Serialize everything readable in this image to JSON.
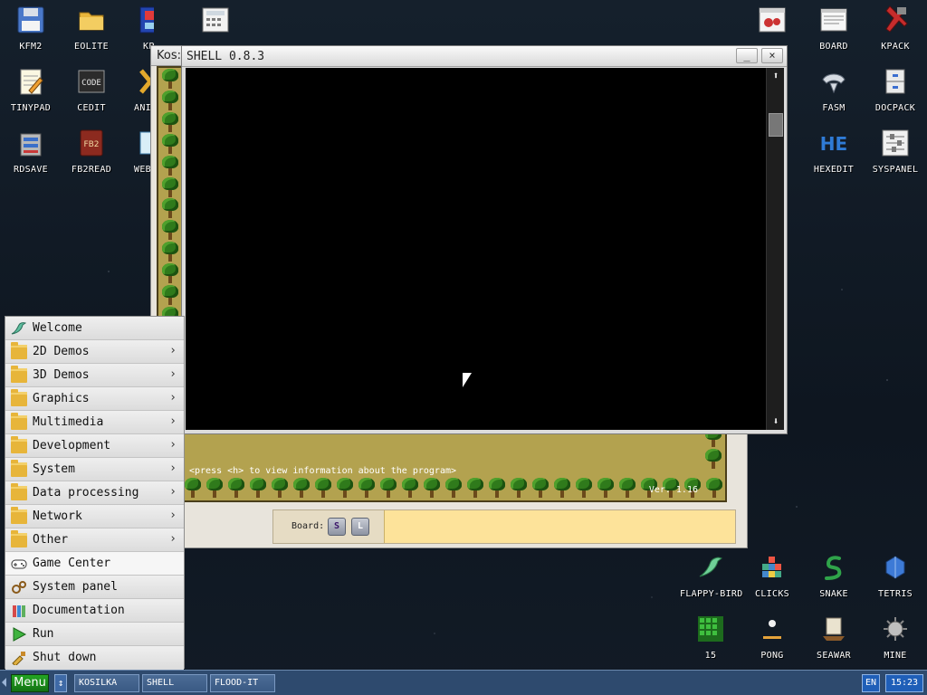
{
  "desktop": {
    "left_icons": [
      {
        "label": "KFM2",
        "icon": "floppy-disk-icon"
      },
      {
        "label": "EOLITE",
        "icon": "folder-icon"
      },
      {
        "label": "KP",
        "icon": "kpaint-icon"
      },
      {
        "label": "",
        "icon": "calculator-icon"
      },
      {
        "label": "TINYPAD",
        "icon": "notepad-icon"
      },
      {
        "label": "CEDIT",
        "icon": "code-editor-icon"
      },
      {
        "label": "ANI",
        "icon": "animation-icon"
      },
      {
        "label": "RDSAVE",
        "icon": "ramdisk-save-icon"
      },
      {
        "label": "FB2READ",
        "icon": "book-reader-icon"
      },
      {
        "label": "WEB",
        "icon": "web-browser-icon"
      }
    ],
    "right_icons": [
      {
        "label": "",
        "icon": "debugger-icon"
      },
      {
        "label": "BOARD",
        "icon": "board-icon"
      },
      {
        "label": "KPACK",
        "icon": "kpack-icon"
      },
      {
        "label": "FASM",
        "icon": "fasm-icon"
      },
      {
        "label": "DOCPACK",
        "icon": "docpack-icon"
      },
      {
        "label": "HEXEDIT",
        "icon": "hex-editor-icon"
      },
      {
        "label": "SYSPANEL",
        "icon": "syspanel-icon"
      }
    ],
    "game_icons": [
      {
        "label": "FLAPPY-BIRD",
        "icon": "flappy-bird-icon"
      },
      {
        "label": "CLICKS",
        "icon": "clicks-icon"
      },
      {
        "label": "SNAKE",
        "icon": "snake-icon"
      },
      {
        "label": "TETRIS",
        "icon": "tetris-icon"
      },
      {
        "label": "15",
        "icon": "fifteen-puzzle-icon"
      },
      {
        "label": "PONG",
        "icon": "pong-icon"
      },
      {
        "label": "SEAWAR",
        "icon": "seawar-icon"
      },
      {
        "label": "MINE",
        "icon": "mine-icon"
      }
    ]
  },
  "kosilka": {
    "title": "Kos:",
    "hint": "<press <h> to view information about the program>",
    "version": "Ver. 1.16",
    "board_label": "Board:",
    "board_s": "S",
    "board_l": "L"
  },
  "shell": {
    "title": "SHELL 0.8.3",
    "minimize": "_",
    "close": "×",
    "scroll_up": "⬆",
    "scroll_down": "⬇"
  },
  "start_menu": {
    "items": [
      {
        "label": "Welcome",
        "icon": "hummingbird-icon",
        "submenu": false
      },
      {
        "label": "2D Demos",
        "icon": "folder-icon",
        "submenu": true
      },
      {
        "label": "3D Demos",
        "icon": "folder-icon",
        "submenu": true
      },
      {
        "label": "Graphics",
        "icon": "folder-icon",
        "submenu": true
      },
      {
        "label": "Multimedia",
        "icon": "folder-icon",
        "submenu": true
      },
      {
        "label": "Development",
        "icon": "folder-icon",
        "submenu": true
      },
      {
        "label": "System",
        "icon": "folder-icon",
        "submenu": true
      },
      {
        "label": "Data processing",
        "icon": "folder-icon",
        "submenu": true
      },
      {
        "label": "Network",
        "icon": "folder-icon",
        "submenu": true
      },
      {
        "label": "Other",
        "icon": "folder-icon",
        "submenu": true
      },
      {
        "label": "Game Center",
        "icon": "gamepad-icon",
        "submenu": false
      },
      {
        "label": "System panel",
        "icon": "gears-icon",
        "submenu": false
      },
      {
        "label": "Documentation",
        "icon": "books-icon",
        "submenu": false
      },
      {
        "label": "Run",
        "icon": "play-icon",
        "submenu": false
      },
      {
        "label": "Shut down",
        "icon": "shutdown-icon",
        "submenu": false
      }
    ],
    "submenu_arrow": "›"
  },
  "taskbar": {
    "menu_label": "Menu",
    "switch_glyph": "↕",
    "tasks": [
      "KOSILKA",
      "SHELL",
      "FLOOD-IT"
    ],
    "language": "EN",
    "clock": "15:23"
  }
}
